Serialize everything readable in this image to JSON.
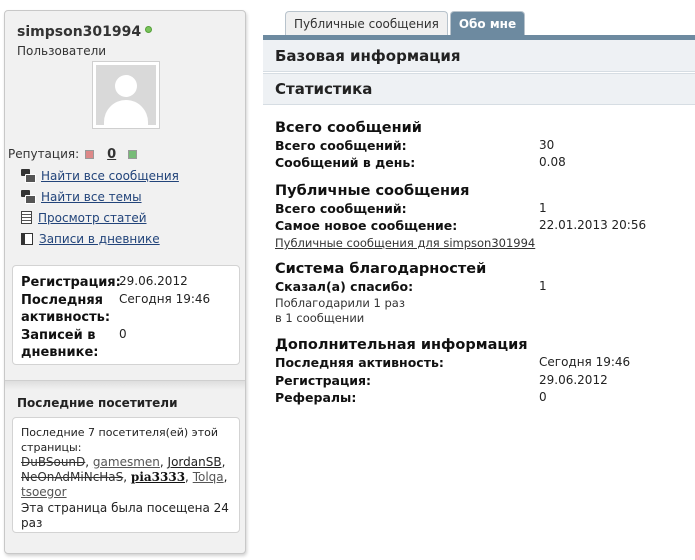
{
  "profile": {
    "username": "simpson301994",
    "usertitle": "Пользователи",
    "reputation_label": "Репутация:",
    "reputation_value": "0"
  },
  "actions": [
    {
      "label": "Найти все сообщения",
      "icon": "messages-icon"
    },
    {
      "label": "Найти все темы",
      "icon": "threads-icon"
    },
    {
      "label": "Просмотр статей",
      "icon": "articles-icon"
    },
    {
      "label": "Записи в дневнике",
      "icon": "diary-icon"
    }
  ],
  "info": {
    "registration_label": "Регистрация:",
    "registration_value": "29.06.2012",
    "activity_label_line1": "Последняя",
    "activity_label_line2": "активность:",
    "activity_value": "Сегодня 19:46",
    "diary_label_line1": "Записей в",
    "diary_label_line2": "дневнике:",
    "diary_value": "0"
  },
  "visitors": {
    "title": "Последние посетители",
    "intro": "Последние 7 посетителя(ей) этой страницы:",
    "list": [
      {
        "name": "DuBSounD",
        "style": "struck"
      },
      {
        "name": "gamesmen",
        "style": "normal"
      },
      {
        "name": "JordanSB",
        "style": "dark"
      },
      {
        "name": "NeOnAdMiNcHaS",
        "style": "struck"
      },
      {
        "name": "pia3333",
        "style": "bold"
      },
      {
        "name": "Tolqa",
        "style": "normal"
      },
      {
        "name": "tsoegor",
        "style": "normal"
      }
    ],
    "visits": "Эта страница была посещена 24 раз"
  },
  "tabs": [
    {
      "label": "Публичные сообщения",
      "active": false
    },
    {
      "label": "Обо мне",
      "active": true
    }
  ],
  "main": {
    "basic_info_title": "Базовая информация",
    "statistics_title": "Статистика",
    "total": {
      "title": "Всего сообщений",
      "total_label": "Всего сообщений:",
      "total_value": "30",
      "per_day_label": "Сообщений в день:",
      "per_day_value": "0.08"
    },
    "public": {
      "title": "Публичные сообщения",
      "total_label": "Всего сообщений:",
      "total_value": "1",
      "newest_label": "Самое новое сообщение:",
      "newest_value": "22.01.2013 20:56",
      "link": "Публичные сообщения для simpson301994"
    },
    "thanks": {
      "title": "Система благодарностей",
      "said_label": "Сказал(а) спасибо:",
      "said_value": "1",
      "thanked_line1": "Поблагодарили 1 раз",
      "thanked_line2": "в 1 сообщении"
    },
    "extra": {
      "title": "Дополнительная информация",
      "activity_label": "Последняя активность:",
      "activity_value": "Сегодня 19:46",
      "registration_label": "Регистрация:",
      "registration_value": "29.06.2012",
      "referrals_label": "Рефералы:",
      "referrals_value": "0"
    }
  },
  "colors": {
    "tab_active": "#6d8aa0",
    "link": "#22447a",
    "online": "#7ac35b"
  }
}
